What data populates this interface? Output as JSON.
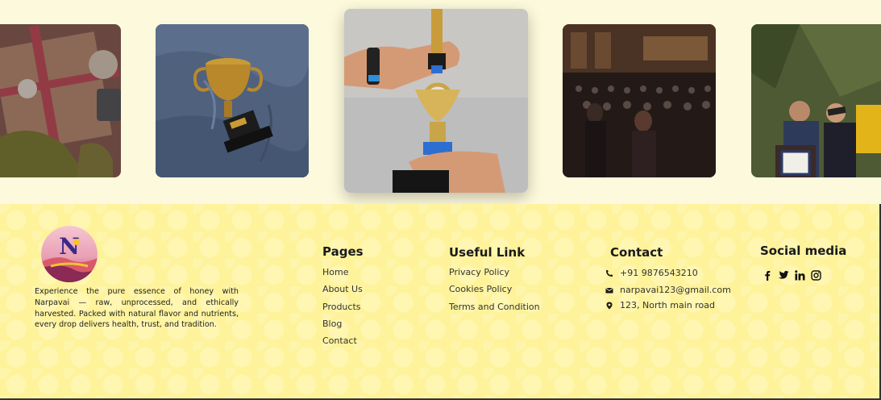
{
  "gallery": {
    "photos": [
      {
        "alt": "gift-box-photo"
      },
      {
        "alt": "trophy-on-fabric-photo"
      },
      {
        "alt": "trophy-handover-photo"
      },
      {
        "alt": "auditorium-ceremony-photo"
      },
      {
        "alt": "graduation-photo"
      }
    ]
  },
  "footer": {
    "about_text": "Experience the pure essence of honey with Narpavai — raw, unprocessed, and ethically harvested. Packed with natural flavor and nutrients, every drop delivers health, trust, and tradition.",
    "pages": {
      "title": "Pages",
      "items": [
        "Home",
        "About Us",
        "Products",
        "Blog",
        "Contact"
      ]
    },
    "useful": {
      "title": "Useful Link",
      "items": [
        "Privacy Policy",
        "Cookies Policy",
        "Terms and Condition"
      ]
    },
    "contact": {
      "title": "Contact",
      "phone": "+91 9876543210",
      "email": "narpavai123@gmail.com",
      "address": "123, North main road"
    },
    "social": {
      "title": "Social media",
      "icons": [
        "facebook-icon",
        "twitter-icon",
        "linkedin-icon",
        "instagram-icon"
      ]
    }
  },
  "colors": {
    "footer_bg": "#fef39b",
    "page_bg": "#fdf9dc"
  }
}
